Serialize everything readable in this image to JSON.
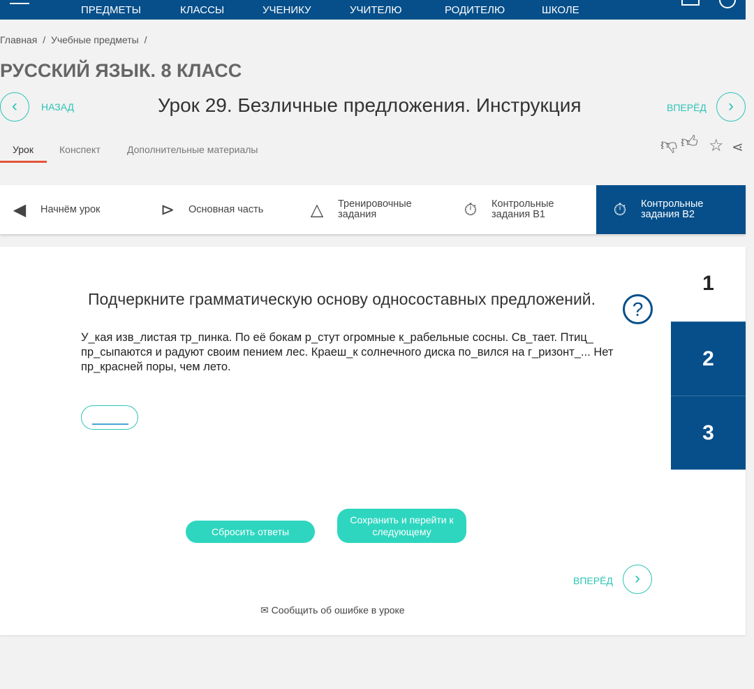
{
  "topnav": {
    "items": [
      "ПРЕДМЕТЫ",
      "КЛАССЫ",
      "УЧЕНИКУ",
      "УЧИТЕЛЮ",
      "РОДИТЕЛЮ",
      "ШКОЛЕ"
    ]
  },
  "breadcrumb": [
    "Главная",
    "/",
    "Учебные предметы",
    "/"
  ],
  "course_title": "РУССКИЙ ЯЗЫК. 8 КЛАСС",
  "lesson": {
    "back": "НАЗАД",
    "forward": "ВПЕРЁД",
    "title": "Урок 29. Безличные предложения. Инструкция"
  },
  "tabs": [
    "Урок",
    "Конспект",
    "Дополнительные материалы"
  ],
  "steps": [
    {
      "label": "Начнём урок",
      "icon": "megaphone-icon"
    },
    {
      "label": "Основная часть",
      "icon": "play-icon"
    },
    {
      "label": "Тренировочные задания",
      "icon": "pyramid-icon"
    },
    {
      "label": "Контрольные задания В1",
      "icon": "stopwatch-icon"
    },
    {
      "label": "Контрольные задания В2",
      "icon": "stopwatch-icon",
      "active": true
    }
  ],
  "task": {
    "title": "Подчеркните грамматическую основу односоставных предложений.",
    "text": "У_кая изв_листая тр_пинка. По её бокам р_стут огромные к_рабельные сосны. Св_тает. Птиц_ пр_сыпаются и радуют своим пением лес. Краеш_к солнечного диска по_вился на г_ризонт_... Нет пр_красней поры, чем лето.",
    "help": "?"
  },
  "questions": [
    "1",
    "2",
    "3"
  ],
  "buttons": {
    "reset": "Сбросить ответы",
    "save": "Сохранить и перейти к следующему",
    "forward": "ВПЕРЁД"
  },
  "report": "Сообщить об ошибке в уроке",
  "colors": {
    "brand": "#064f8a",
    "accent": "#2ec4b6",
    "button": "#2ed6bf",
    "tab_underline": "#e4543a"
  }
}
